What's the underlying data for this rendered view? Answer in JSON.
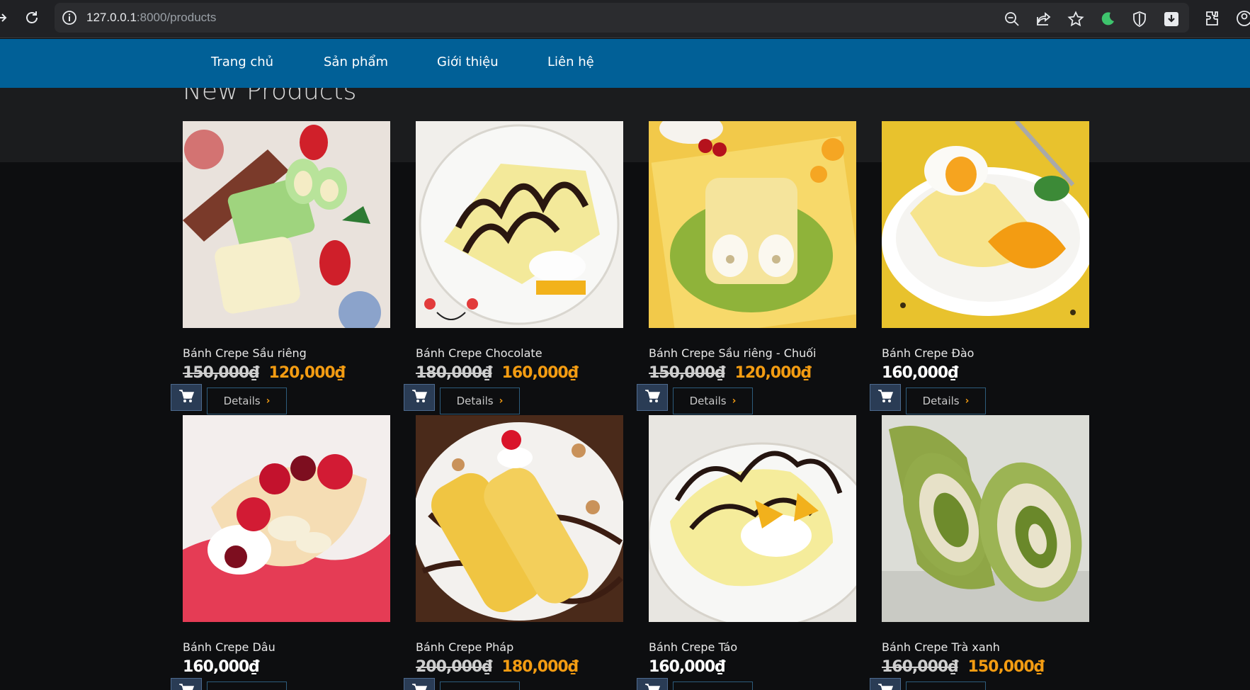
{
  "browser": {
    "url_host": "127.0.0.1",
    "url_path": ":8000/products"
  },
  "nav": {
    "items": [
      "Trang chủ",
      "Sản phẩm",
      "Giới thiệu",
      "Liên hệ"
    ]
  },
  "section": {
    "title": "New Products"
  },
  "details_label": "Details",
  "currency": "₫",
  "products": [
    {
      "name": "Bánh Crepe Sầu riêng",
      "old_price": "150,000₫",
      "price": "120,000₫"
    },
    {
      "name": "Bánh Crepe Chocolate",
      "old_price": "180,000₫",
      "price": "160,000₫"
    },
    {
      "name": "Bánh Crepe Sầu riêng - Chuối",
      "old_price": "150,000₫",
      "price": "120,000₫"
    },
    {
      "name": "Bánh Crepe Đào",
      "old_price": "",
      "price": "160,000₫"
    },
    {
      "name": "Bánh Crepe Dâu",
      "old_price": "",
      "price": "160,000₫"
    },
    {
      "name": "Bánh Crepe Pháp",
      "old_price": "200,000₫",
      "price": "180,000₫"
    },
    {
      "name": "Bánh Crepe Táo",
      "old_price": "",
      "price": "160,000₫"
    },
    {
      "name": "Bánh Crepe Trà xanh",
      "old_price": "160,000₫",
      "price": "150,000₫"
    }
  ],
  "colors": {
    "nav_bg": "#016097",
    "price_accent": "#f39c12",
    "page_bg": "#0d0e10"
  }
}
